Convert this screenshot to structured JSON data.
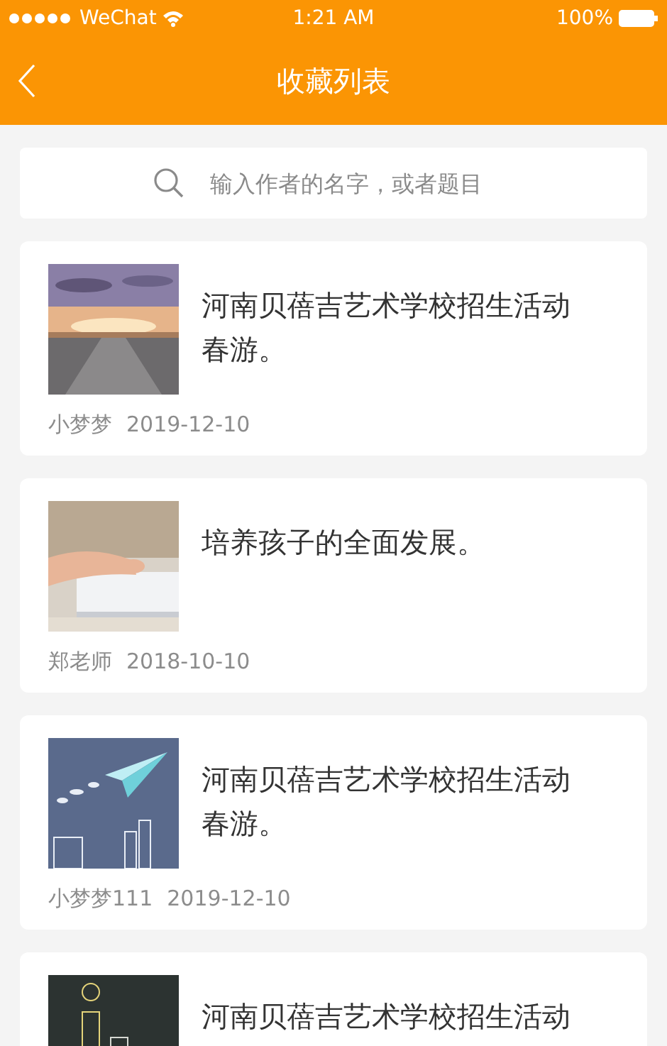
{
  "status_bar": {
    "carrier": "WeChat",
    "time": "1:21 AM",
    "battery": "100%"
  },
  "nav_bar": {
    "title": "收藏列表"
  },
  "search": {
    "placeholder": "输入作者的名字，或者题目"
  },
  "articles": [
    {
      "title": "河南贝蓓吉艺术学校招生活动春游。",
      "author": "小梦梦",
      "date": "2019-12-10"
    },
    {
      "title": "培养孩子的全面发展。",
      "author": "郑老师",
      "date": "2018-10-10"
    },
    {
      "title": "河南贝蓓吉艺术学校招生活动春游。",
      "author": "小梦梦111",
      "date": "2019-12-10"
    },
    {
      "title": "河南贝蓓吉艺术学校招生活动"
    }
  ]
}
